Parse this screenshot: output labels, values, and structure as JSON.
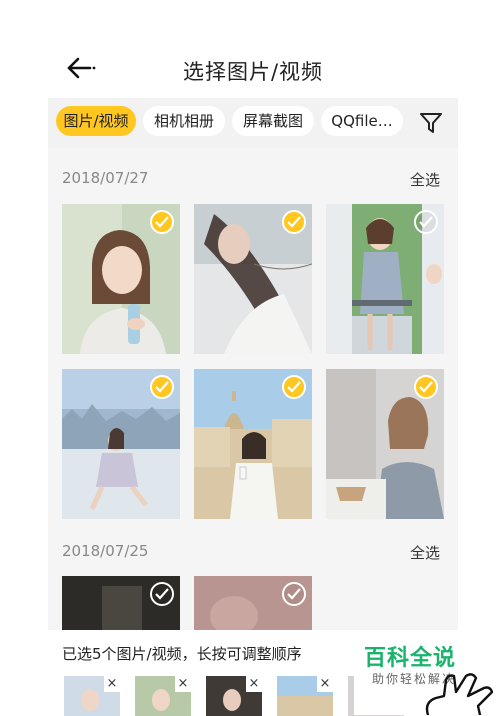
{
  "header": {
    "title": "选择图片/视频"
  },
  "tabs": [
    {
      "label": "图片/视频",
      "active": true
    },
    {
      "label": "相机相册",
      "active": false
    },
    {
      "label": "屏幕截图",
      "active": false
    },
    {
      "label": "QQfile…",
      "active": false
    }
  ],
  "groups": [
    {
      "date": "2018/07/27",
      "select_all": "全选",
      "photos": [
        {
          "selected": true,
          "scene": "girl-with-bottle"
        },
        {
          "selected": true,
          "scene": "windblown-hair"
        },
        {
          "selected": false,
          "scene": "girl-on-balcony"
        },
        {
          "selected": true,
          "scene": "sitting-by-sea"
        },
        {
          "selected": true,
          "scene": "cathedral-square"
        },
        {
          "selected": true,
          "scene": "smiling-at-table"
        }
      ]
    },
    {
      "date": "2018/07/25",
      "select_all": "全选",
      "photos": [
        {
          "selected": false,
          "scene": "dark-photo"
        },
        {
          "selected": false,
          "scene": "pink-photo"
        }
      ]
    }
  ],
  "selection_bar": {
    "hint": "已选5个图片/视频，长按可调整顺序",
    "remove_symbol": "×",
    "count": 5
  },
  "watermark": {
    "title": "百科全说",
    "subtitle": "助你轻松解决"
  },
  "colors": {
    "accent": "#ffc71f",
    "watermark_green": "#19b36b",
    "background": "#f5f5f5"
  }
}
